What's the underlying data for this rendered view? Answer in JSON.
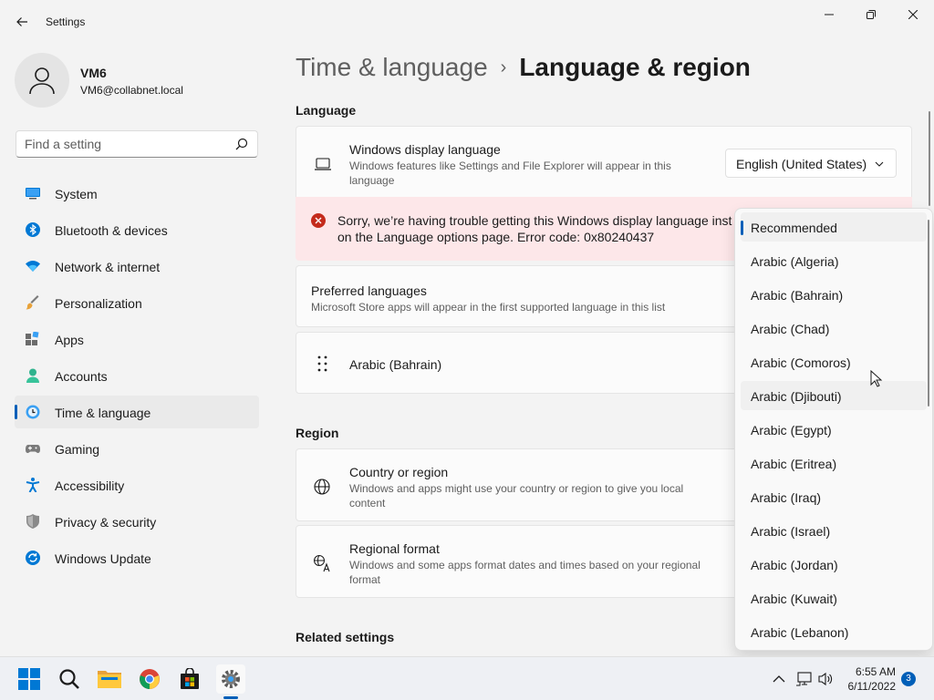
{
  "window": {
    "title": "Settings"
  },
  "profile": {
    "name": "VM6",
    "email": "VM6@collabnet.local"
  },
  "search": {
    "placeholder": "Find a setting"
  },
  "sidebar": {
    "items": [
      {
        "label": "System",
        "icon": "system-icon"
      },
      {
        "label": "Bluetooth & devices",
        "icon": "bluetooth-icon"
      },
      {
        "label": "Network & internet",
        "icon": "wifi-icon"
      },
      {
        "label": "Personalization",
        "icon": "brush-icon"
      },
      {
        "label": "Apps",
        "icon": "apps-icon"
      },
      {
        "label": "Accounts",
        "icon": "person-icon"
      },
      {
        "label": "Time & language",
        "icon": "clock-globe-icon",
        "active": true
      },
      {
        "label": "Gaming",
        "icon": "gamepad-icon"
      },
      {
        "label": "Accessibility",
        "icon": "accessibility-icon"
      },
      {
        "label": "Privacy & security",
        "icon": "shield-icon"
      },
      {
        "label": "Windows Update",
        "icon": "update-icon"
      }
    ]
  },
  "breadcrumb": {
    "parent": "Time & language",
    "separator": "›",
    "current": "Language & region"
  },
  "language": {
    "section_title": "Language",
    "display_language": {
      "title": "Windows display language",
      "subtitle": "Windows features like Settings and File Explorer will appear in this language",
      "value": "English (United States)"
    },
    "error": "Sorry, we’re having trouble getting this Windows display language inst\non the Language options page. Error code: 0x80240437",
    "preferred": {
      "title": "Preferred languages",
      "subtitle": "Microsoft Store apps will appear in the first supported language in this list"
    },
    "preferred_item": "Arabic (Bahrain)"
  },
  "region": {
    "section_title": "Region",
    "country": {
      "title": "Country or region",
      "subtitle": "Windows and apps might use your country or region to give you local content"
    },
    "format": {
      "title": "Regional format",
      "subtitle": "Windows and some apps format dates and times based on your regional format"
    }
  },
  "related": {
    "section_title": "Related settings"
  },
  "dropdown": {
    "options": [
      "Recommended",
      "Arabic (Algeria)",
      "Arabic (Bahrain)",
      "Arabic (Chad)",
      "Arabic (Comoros)",
      "Arabic (Djibouti)",
      "Arabic (Egypt)",
      "Arabic (Eritrea)",
      "Arabic (Iraq)",
      "Arabic (Israel)",
      "Arabic (Jordan)",
      "Arabic (Kuwait)",
      "Arabic (Lebanon)"
    ],
    "selected_index": 0,
    "hover_index": 5
  },
  "taskbar": {
    "time": "6:55 AM",
    "date": "6/11/2022",
    "notifications": "3"
  },
  "colors": {
    "accent": "#005fb8",
    "error_bg": "#fde7e9",
    "error_icon": "#c42b1c"
  }
}
